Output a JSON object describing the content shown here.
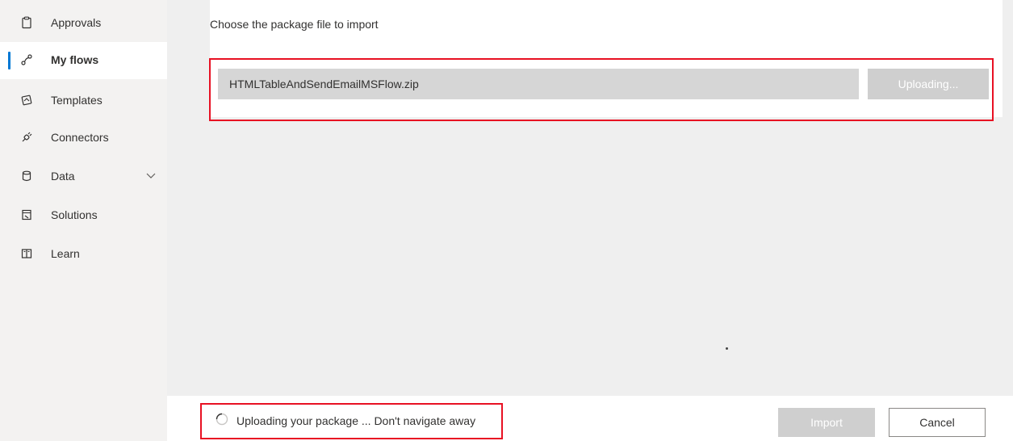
{
  "sidebar": {
    "items": [
      {
        "label": "Approvals",
        "icon": "clipboard-icon"
      },
      {
        "label": "My flows",
        "icon": "flow-icon",
        "active": true
      },
      {
        "label": "Templates",
        "icon": "templates-icon"
      },
      {
        "label": "Connectors",
        "icon": "connector-plug-icon"
      },
      {
        "label": "Data",
        "icon": "database-icon",
        "expandable": true
      },
      {
        "label": "Solutions",
        "icon": "solutions-icon"
      },
      {
        "label": "Learn",
        "icon": "book-icon"
      }
    ]
  },
  "import": {
    "choose_label": "Choose the package file to import",
    "file_name": "HTMLTableAndSendEmailMSFlow.zip",
    "upload_button": "Uploading..."
  },
  "footer": {
    "status_text": "Uploading your package ... Don't navigate away",
    "import_button": "Import",
    "cancel_button": "Cancel"
  },
  "colors": {
    "accent": "#0078d4",
    "highlight": "#e81123",
    "disabled_button": "#cfcfcf",
    "sidebar_bg": "#f3f2f1",
    "content_bg": "#efefef"
  }
}
